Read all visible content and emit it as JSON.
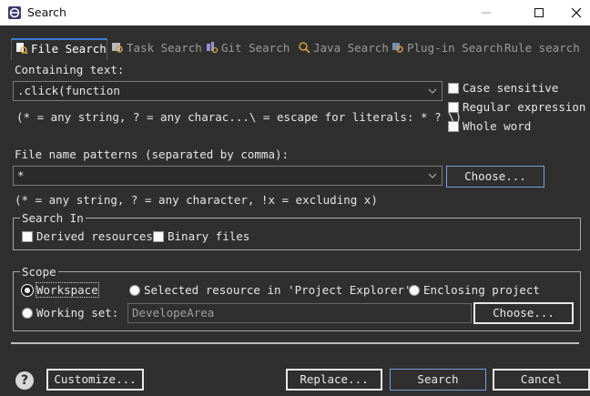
{
  "window": {
    "title": "Search"
  },
  "tabs": [
    {
      "label": "File Search",
      "icon": "file-search-icon",
      "active": true
    },
    {
      "label": "Task Search",
      "icon": "task-search-icon",
      "active": false
    },
    {
      "label": "Git Search",
      "icon": "git-search-icon",
      "active": false
    },
    {
      "label": "Java Search",
      "icon": "java-search-icon",
      "active": false
    },
    {
      "label": "Plug-in Search",
      "icon": "plugin-search-icon",
      "active": false
    },
    {
      "label": "Rule search",
      "icon": "",
      "active": false
    }
  ],
  "containing": {
    "label": "Containing text:",
    "value": ".click(function",
    "hint": "(* = any string, ? = any charac...\\ = escape for literals: * ? \\)"
  },
  "options": {
    "case_sensitive": "Case sensitive",
    "regex": "Regular expression",
    "whole_word": "Whole word"
  },
  "patterns": {
    "label": "File name patterns (separated by comma):",
    "value": "*",
    "choose": "Choose...",
    "hint": "(* = any string, ? = any character, !x = excluding x)"
  },
  "search_in": {
    "title": "Search In",
    "derived": "Derived resources",
    "binary": "Binary files"
  },
  "scope": {
    "title": "Scope",
    "workspace": "Workspace",
    "selected": "Selected resource in 'Project Explorer'",
    "enclosing": "Enclosing project",
    "working_set": "Working set:",
    "working_set_value": "DevelopeArea",
    "choose": "Choose..."
  },
  "buttons": {
    "customize": "Customize...",
    "replace": "Replace...",
    "search": "Search",
    "cancel": "Cancel"
  },
  "colors": {
    "background": "#2f2f2f",
    "accent": "#3c7cd6"
  }
}
